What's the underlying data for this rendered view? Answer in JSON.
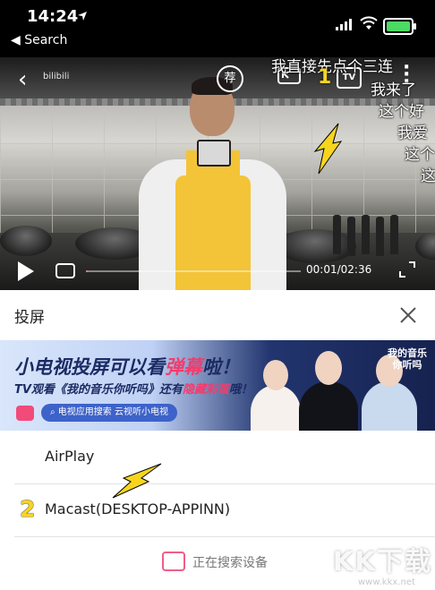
{
  "status_bar": {
    "time": "14:24",
    "back_app": "Search"
  },
  "video": {
    "channel_logo": "bilibili",
    "recommend_icon": "荐",
    "tv_icon": "TV",
    "danmaku": [
      "我直接先点个三连",
      "我来了",
      "这个好",
      "我爱",
      "这个",
      "这"
    ],
    "time_display": "00:01/02:36",
    "annotation": "1"
  },
  "cast_panel": {
    "title": "投屏",
    "banner": {
      "headline_part1": "小电视投屏可以看",
      "headline_highlight": "弹幕",
      "headline_part2": "啦！",
      "subline_part1": "TV观看《我的音乐你听吗》还有",
      "subline_highlight": "隐藏彩蛋",
      "subline_part2": "哦！",
      "pill": "电视应用搜索 云视听小电视",
      "show_logo": "我的音乐你听吗"
    },
    "devices": [
      "AirPlay",
      "Macast(DESKTOP-APPINN)"
    ],
    "device_annotation": "2",
    "searching_text": "正在搜索设备"
  },
  "watermark": {
    "brand": "KK下载",
    "url": "www.kkx.net"
  },
  "colors": {
    "accent_pink": "#fb7299",
    "annotation_yellow": "#f7d51e",
    "banner_pink": "#f23c6d",
    "banner_navy": "#1b2b63"
  }
}
